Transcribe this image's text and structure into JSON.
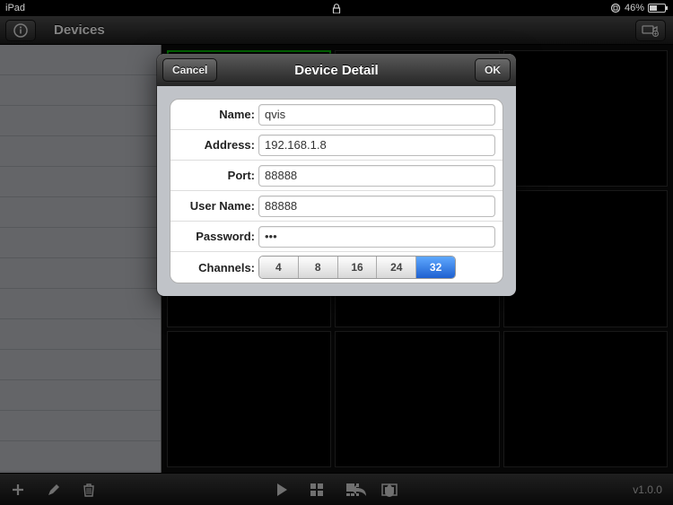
{
  "status": {
    "device": "iPad",
    "battery_text": "46%"
  },
  "header": {
    "title": "Devices"
  },
  "modal": {
    "title": "Device Detail",
    "cancel_label": "Cancel",
    "ok_label": "OK",
    "fields": {
      "name_label": "Name:",
      "name_value": "qvis",
      "address_label": "Address:",
      "address_value": "192.168.1.8",
      "port_label": "Port:",
      "port_value": "88888",
      "user_label": "User Name:",
      "user_value": "88888",
      "password_label": "Password:",
      "password_value": "•••",
      "channels_label": "Channels:",
      "channels_options": [
        "4",
        "8",
        "16",
        "24",
        "32"
      ],
      "channels_selected": "32"
    }
  },
  "footer": {
    "version": "v1.0.0"
  }
}
